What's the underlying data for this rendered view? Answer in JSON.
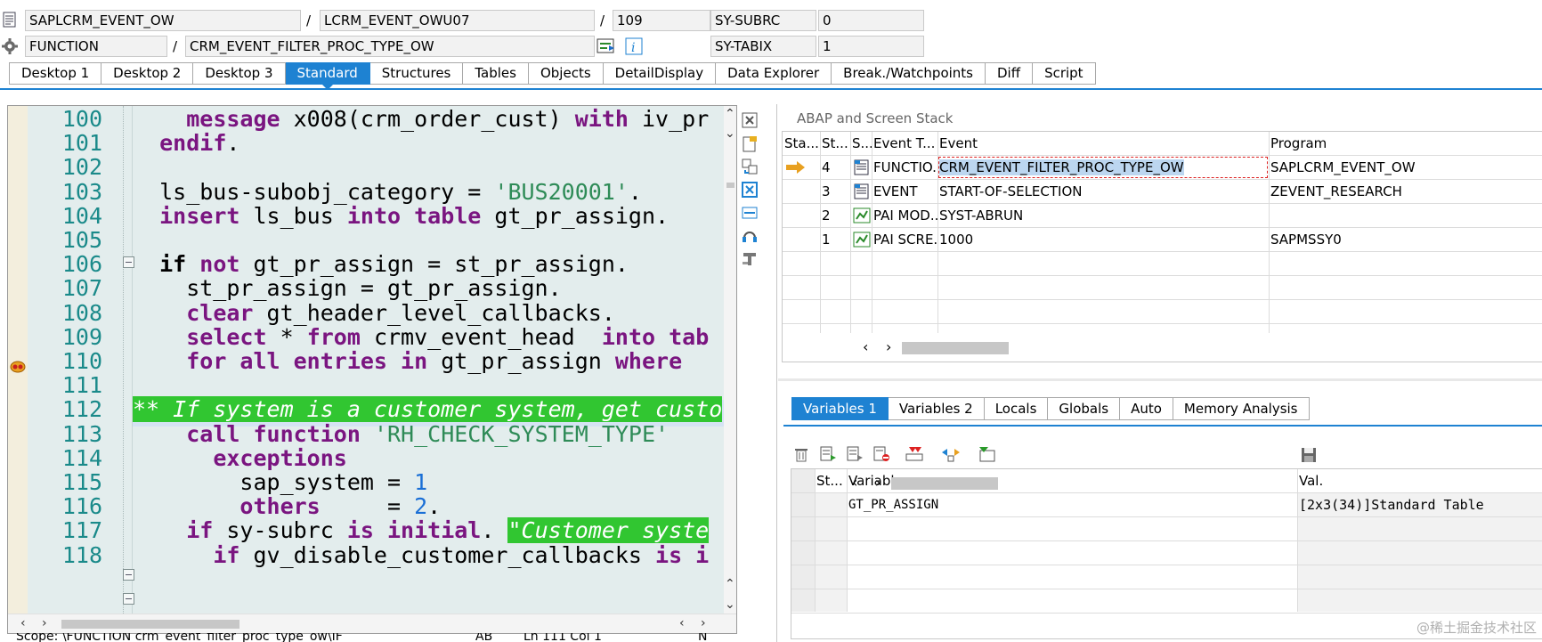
{
  "header": {
    "row1": {
      "program": "SAPLCRM_EVENT_OW",
      "include": "LCRM_EVENT_OWU07",
      "line": "109",
      "var_name": "SY-SUBRC",
      "var_value": "0"
    },
    "row2": {
      "type": "FUNCTION",
      "name": "CRM_EVENT_FILTER_PROC_TYPE_OW",
      "var_name": "SY-TABIX",
      "var_value": "1"
    },
    "separator": "/"
  },
  "tabs": [
    "Desktop 1",
    "Desktop 2",
    "Desktop 3",
    "Standard",
    "Structures",
    "Tables",
    "Objects",
    "DetailDisplay",
    "Data Explorer",
    "Break./Watchpoints",
    "Diff",
    "Script"
  ],
  "active_tab": "Standard",
  "editor": {
    "lines": [
      {
        "n": "100",
        "html": "    <span class='kw'>message</span> x008(crm_order_cust) <span class='kw'>with</span> iv_pr"
      },
      {
        "n": "101",
        "html": "  <span class='kw'>endif</span>."
      },
      {
        "n": "102",
        "html": ""
      },
      {
        "n": "103",
        "html": "  ls_bus-subobj_category = <span class='str'>'BUS20001'</span>."
      },
      {
        "n": "104",
        "html": "  <span class='kw'>insert</span> ls_bus <span class='kw'>into table</span> gt_pr_assign."
      },
      {
        "n": "105",
        "html": ""
      },
      {
        "n": "106",
        "html": "  <span class='kw' style='color:#000'>if</span> <span class='kw'>not</span> gt_pr_assign = st_pr_assign."
      },
      {
        "n": "107",
        "html": "    st_pr_assign = gt_pr_assign."
      },
      {
        "n": "108",
        "html": "    <span class='kw'>clear</span> gt_header_level_callbacks."
      },
      {
        "n": "109",
        "html": "    <span class='kw'>select</span> * <span class='kw'>from</span> crmv_event_head  <span class='kw'>into</span> <span class='kw'>tab</span>"
      },
      {
        "n": "110",
        "html": "    <span class='kw'>for all entries in</span> gt_pr_assign <span class='kw'>where</span>"
      },
      {
        "n": "111",
        "html": ""
      },
      {
        "n": "112",
        "html": "<span class='cmt'>** If system is a customer system, get custo</span>"
      },
      {
        "n": "113",
        "html": "    <span class='kw'>call function</span> <span class='str'>'RH_CHECK_SYSTEM_TYPE'</span>"
      },
      {
        "n": "114",
        "html": "      <span class='kw'>exceptions</span>"
      },
      {
        "n": "115",
        "html": "        sap_system = <span class='num'>1</span>"
      },
      {
        "n": "116",
        "html": "        <span class='kw'>others</span>     = <span class='num'>2</span>."
      },
      {
        "n": "117",
        "html": "    <span class='kw'>if</span> sy-subrc <span class='kw'>is initial</span>. <span class='cmt'>\"Customer syste</span>"
      },
      {
        "n": "118",
        "html": "      <span class='kw'>if</span> gv_disable_customer_callbacks <span class='kw'>is i</span>"
      }
    ]
  },
  "status_bar": {
    "scope": "Scope: \\FUNCTION crm_event_filter_proc_type_ow\\IF",
    "mode": "AB",
    "position": "Ln 111 Col 1",
    "nm": "N"
  },
  "stack": {
    "title": "ABAP and Screen Stack",
    "columns": [
      "Sta...",
      "St...",
      "S...",
      "Event T...",
      "Event",
      "Program"
    ],
    "rows": [
      {
        "level": "4",
        "type": "FUNCTIO...",
        "event": "CRM_EVENT_FILTER_PROC_TYPE_OW",
        "program": "SAPLCRM_EVENT_OW"
      },
      {
        "level": "3",
        "type": "EVENT",
        "event": "START-OF-SELECTION",
        "program": "ZEVENT_RESEARCH"
      },
      {
        "level": "2",
        "type": "PAI MOD...",
        "event": "SYST-ABRUN",
        "program": ""
      },
      {
        "level": "1",
        "type": "PAI SCRE...",
        "event": "1000",
        "program": "SAPMSSY0"
      }
    ]
  },
  "variables": {
    "tabs": [
      "Variables 1",
      "Variables 2",
      "Locals",
      "Globals",
      "Auto",
      "Memory Analysis"
    ],
    "active_tab": "Variables 1",
    "columns": [
      "St...",
      "Variable",
      "Val."
    ],
    "rows": [
      {
        "name": "GT_PR_ASSIGN",
        "value": "[2x3(34)]Standard Table"
      }
    ]
  },
  "watermark": "@稀土掘金技术社区",
  "colors": {
    "accent": "#1e82d2",
    "comment_bg": "#31c631",
    "keyword": "#7a1580",
    "string": "#2e8b57",
    "number": "#1a6fd6"
  }
}
